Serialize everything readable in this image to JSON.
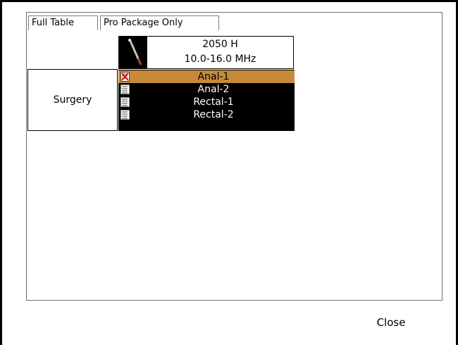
{
  "tabs": [
    {
      "label": "Full Table",
      "active": true
    },
    {
      "label": "Pro Package Only",
      "active": false
    }
  ],
  "probe": {
    "name": "2050 H",
    "frequency": "10.0-16.0 MHz",
    "icon": "probe-image-icon"
  },
  "category": {
    "label": "Surgery"
  },
  "presets": [
    {
      "label": "Anal-1",
      "selected": true,
      "icon": "preset-selected-icon"
    },
    {
      "label": "Anal-2",
      "selected": false,
      "icon": "preset-icon"
    },
    {
      "label": "Rectal-1",
      "selected": false,
      "icon": "preset-icon"
    },
    {
      "label": "Rectal-2",
      "selected": false,
      "icon": "preset-icon"
    }
  ],
  "footer": {
    "close_label": "Close"
  },
  "colors": {
    "selected_row": "#c68a3a",
    "preset_background": "#000000"
  }
}
